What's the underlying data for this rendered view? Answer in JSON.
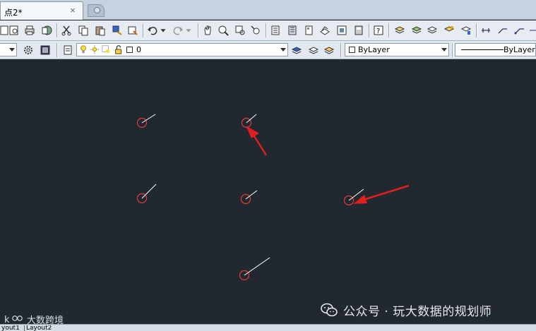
{
  "tab": {
    "title": "点2*",
    "close_label": "×"
  },
  "icons": {
    "toolbar1": [
      "new-icon",
      "open-icon",
      "print-icon",
      "publish-icon",
      "cut-icon",
      "copy-icon",
      "paste-icon",
      "match-properties-icon",
      "undo-icon",
      "undo-dropdown-icon",
      "redo-icon",
      "redo-dropdown-icon",
      "pan-icon",
      "zoom-realtime-icon",
      "zoom-window-icon",
      "zoom-previous-icon",
      "properties-icon",
      "design-center-icon",
      "tool-palettes-icon",
      "sheet-set-icon",
      "markup-icon",
      "calculator-icon",
      "help-icon",
      "layer-properties-icon",
      "layer-state-icon",
      "layer-previous-icon",
      "layer-match-icon",
      "layer-isolate-icon",
      "dimension-icon",
      "leader-icon"
    ],
    "toolbar2": [
      "workspace-settings-icon",
      "fullscreen-icon",
      "layer-manager-icon",
      "lightbulb-on-icon",
      "sun-freeze-icon",
      "viewport-freeze-icon",
      "lock-icon",
      "layer-color-icon",
      "make-current-icon",
      "layer-previous-2-icon",
      "layer-states-icon"
    ]
  },
  "layer_combo": {
    "value": "0"
  },
  "color_combo": {
    "value": "ByLayer"
  },
  "linetype_combo": {
    "value": "ByLayer"
  },
  "canvas": {
    "background": "#212830",
    "marker_color": "#e03a3a",
    "arrow_color": "#e02020"
  },
  "layout_tabs": [
    "yout1",
    "Layout2"
  ],
  "watermark": {
    "text": "公众号 · 玩大数据的规划师",
    "logo_text": "大数跨境"
  }
}
